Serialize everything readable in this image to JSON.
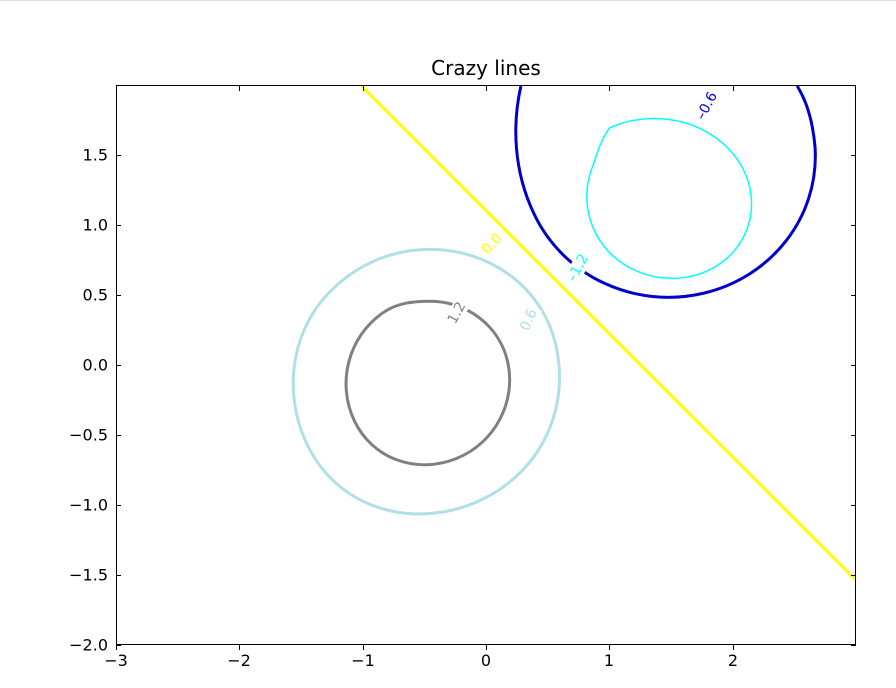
{
  "chart_data": {
    "type": "contour",
    "title": "Crazy lines",
    "xlabel": "",
    "ylabel": "",
    "xlim": [
      -3.0,
      3.0
    ],
    "ylim": [
      -2.0,
      2.0
    ],
    "x_ticks": [
      -3,
      -2,
      -1,
      0,
      1,
      2
    ],
    "y_ticks": [
      -2.0,
      -1.5,
      -1.0,
      -0.5,
      0.0,
      0.5,
      1.0,
      1.5
    ],
    "levels": [
      -1.2,
      -0.6,
      0.0,
      0.6,
      1.2
    ],
    "colors": {
      "-1.2": "#00FFFF",
      "-0.6": "#0000CD",
      "0.0": "#FFFF00",
      "0.6": "#B0E0E6",
      "1.2": "#808080"
    },
    "linewidths": {
      "-1.2": 1.5,
      "-0.6": 3,
      "0.0": 3,
      "0.6": 3,
      "1.2": 3
    },
    "contour_labels": [
      {
        "level": -1.2,
        "text": "–1.2",
        "x": 0.72,
        "y": 0.64,
        "rotation": -62
      },
      {
        "level": -0.6,
        "text": "–0.6",
        "x": 1.77,
        "y": 1.84,
        "rotation": -62
      },
      {
        "level": 0.0,
        "text": "0.0",
        "x": 0.06,
        "y": 0.8,
        "rotation": -45
      },
      {
        "level": 0.6,
        "text": "0.6",
        "x": 0.33,
        "y": 0.26,
        "rotation": -66
      },
      {
        "level": 1.2,
        "text": "1.2",
        "x": -0.23,
        "y": 0.36,
        "rotation": -62
      }
    ],
    "function": "exp(-x^2 - y^2) - exp(-(x-1)^2 - (y-1)^2)"
  }
}
